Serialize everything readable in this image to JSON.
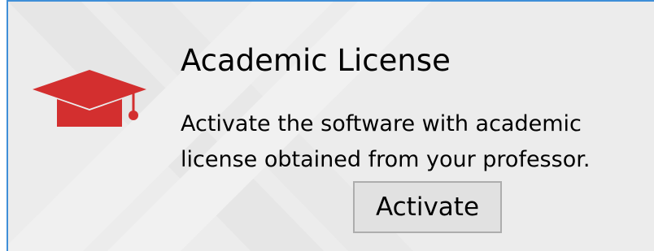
{
  "license_panel": {
    "title": "Academic License",
    "description": "Activate the software with academic license obtained from your professor.",
    "activate_label": "Activate",
    "icon": "graduation-cap-icon",
    "icon_color": "#d32f2f",
    "accent_border_color": "#3f8fd8"
  }
}
